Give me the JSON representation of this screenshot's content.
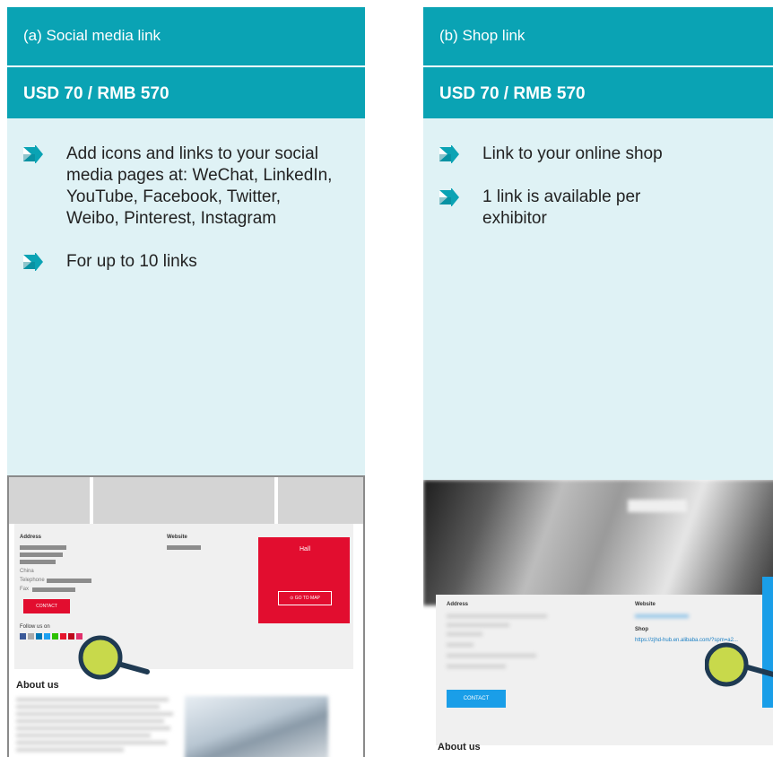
{
  "panel_a": {
    "title": "(a) Social media link",
    "price": "USD 70 / RMB 570",
    "bullets": [
      "Add icons and links to your social media pages at: WeChat, LinkedIn, YouTube, Facebook, Twitter, Weibo, Pinterest, Instagram",
      "For up to 10 links"
    ],
    "screenshot": {
      "address_label": "Address",
      "website_label": "Website",
      "hall_label": "Hall",
      "go_to_map": "GO TO MAP",
      "contact": "CONTACT",
      "follow_us": "Follow us on",
      "china_label": "China",
      "telephone_label": "Telephone",
      "fax_label": "Fax",
      "about_us": "About us"
    }
  },
  "panel_b": {
    "title": "(b) Shop link",
    "price": "USD 70 / RMB 570",
    "bullets": [
      "Link to your online shop",
      "1 link is available per exhibitor"
    ],
    "screenshot": {
      "address_label": "Address",
      "website_label": "Website",
      "shop_label": "Shop",
      "shop_url": "https://zjhd-hub.en.alibaba.com/?spm=a2...",
      "contact": "CONTACT",
      "about_us": "About us"
    }
  },
  "colors": {
    "header_teal": "#0aa3b4",
    "body_light": "#dff2f5",
    "hall_red": "#e20d2f",
    "contact_blue": "#1a9ee8",
    "magnifier_fill": "#c8d94b",
    "magnifier_ring": "#1f3a52"
  },
  "icons": [
    "arrow-right-icon",
    "magnifier-icon",
    "map-pin-icon"
  ]
}
